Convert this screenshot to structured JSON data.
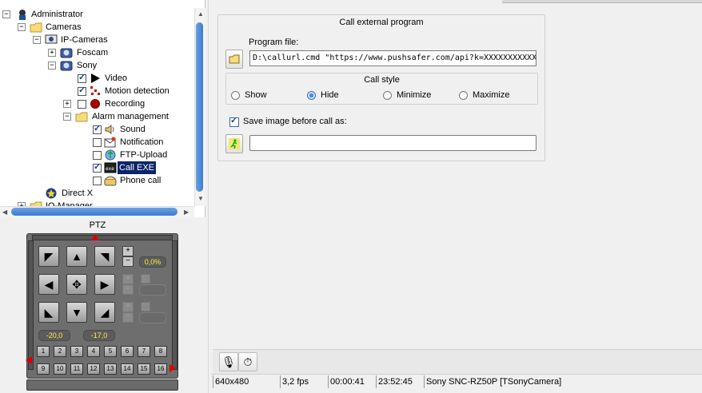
{
  "tree": {
    "items": [
      {
        "label": "Administrator",
        "icon": "admin-icon"
      },
      {
        "label": "Cameras",
        "icon": "folder-icon"
      },
      {
        "label": "IP-Cameras",
        "icon": "network-camera-icon"
      },
      {
        "label": "Foscam",
        "icon": "camera-icon"
      },
      {
        "label": "Sony",
        "icon": "camera-icon"
      },
      {
        "label": "Video",
        "icon": "play-icon",
        "checked": true
      },
      {
        "label": "Motion detection",
        "icon": "motion-icon",
        "checked": true
      },
      {
        "label": "Recording",
        "icon": "record-icon",
        "checked": false
      },
      {
        "label": "Alarm management",
        "icon": "folder-icon"
      },
      {
        "label": "Sound",
        "icon": "speaker-icon",
        "checked": true
      },
      {
        "label": "Notification",
        "icon": "notification-icon",
        "checked": false
      },
      {
        "label": "FTP-Upload",
        "icon": "upload-icon",
        "checked": false
      },
      {
        "label": "Call EXE",
        "icon": "exe-icon",
        "checked": true,
        "selected": true
      },
      {
        "label": "Phone call",
        "icon": "phone-icon",
        "checked": false
      },
      {
        "label": "Direct X",
        "icon": "directx-icon"
      },
      {
        "label": "IO-Manager",
        "icon": "folder-icon"
      }
    ]
  },
  "ptz": {
    "title": "PTZ",
    "zoom_value": "0,0%",
    "pan_value": "-20,0",
    "tilt_value": "-17,0",
    "presets_row1": [
      "1",
      "2",
      "3",
      "4",
      "5",
      "6",
      "7",
      "8"
    ],
    "presets_row2": [
      "9",
      "10",
      "11",
      "12",
      "13",
      "14",
      "15",
      "16"
    ]
  },
  "call_external": {
    "title": "Call external program",
    "program_file_label": "Program file:",
    "program_file_value": "D:\\callurl.cmd \"https://www.pushsafer.com/api?k=XXXXXXXXXXXXXXXX",
    "call_style_title": "Call style",
    "styles": [
      "Show",
      "Hide",
      "Minimize",
      "Maximize"
    ],
    "selected_style": "Hide",
    "save_image_label": "Save image before call as:",
    "save_image_checked": true,
    "save_image_value": ""
  },
  "status": {
    "resolution": "640x480",
    "fps": "3,2 fps",
    "elapsed": "00:00:41",
    "clock": "23:52:45",
    "camera": "Sony SNC-RZ50P [TSonyCamera]"
  },
  "colors": {
    "selection": "#0a246a",
    "scroll_thumb": "#3d7ad0",
    "ptz_value": "#ffef40"
  }
}
